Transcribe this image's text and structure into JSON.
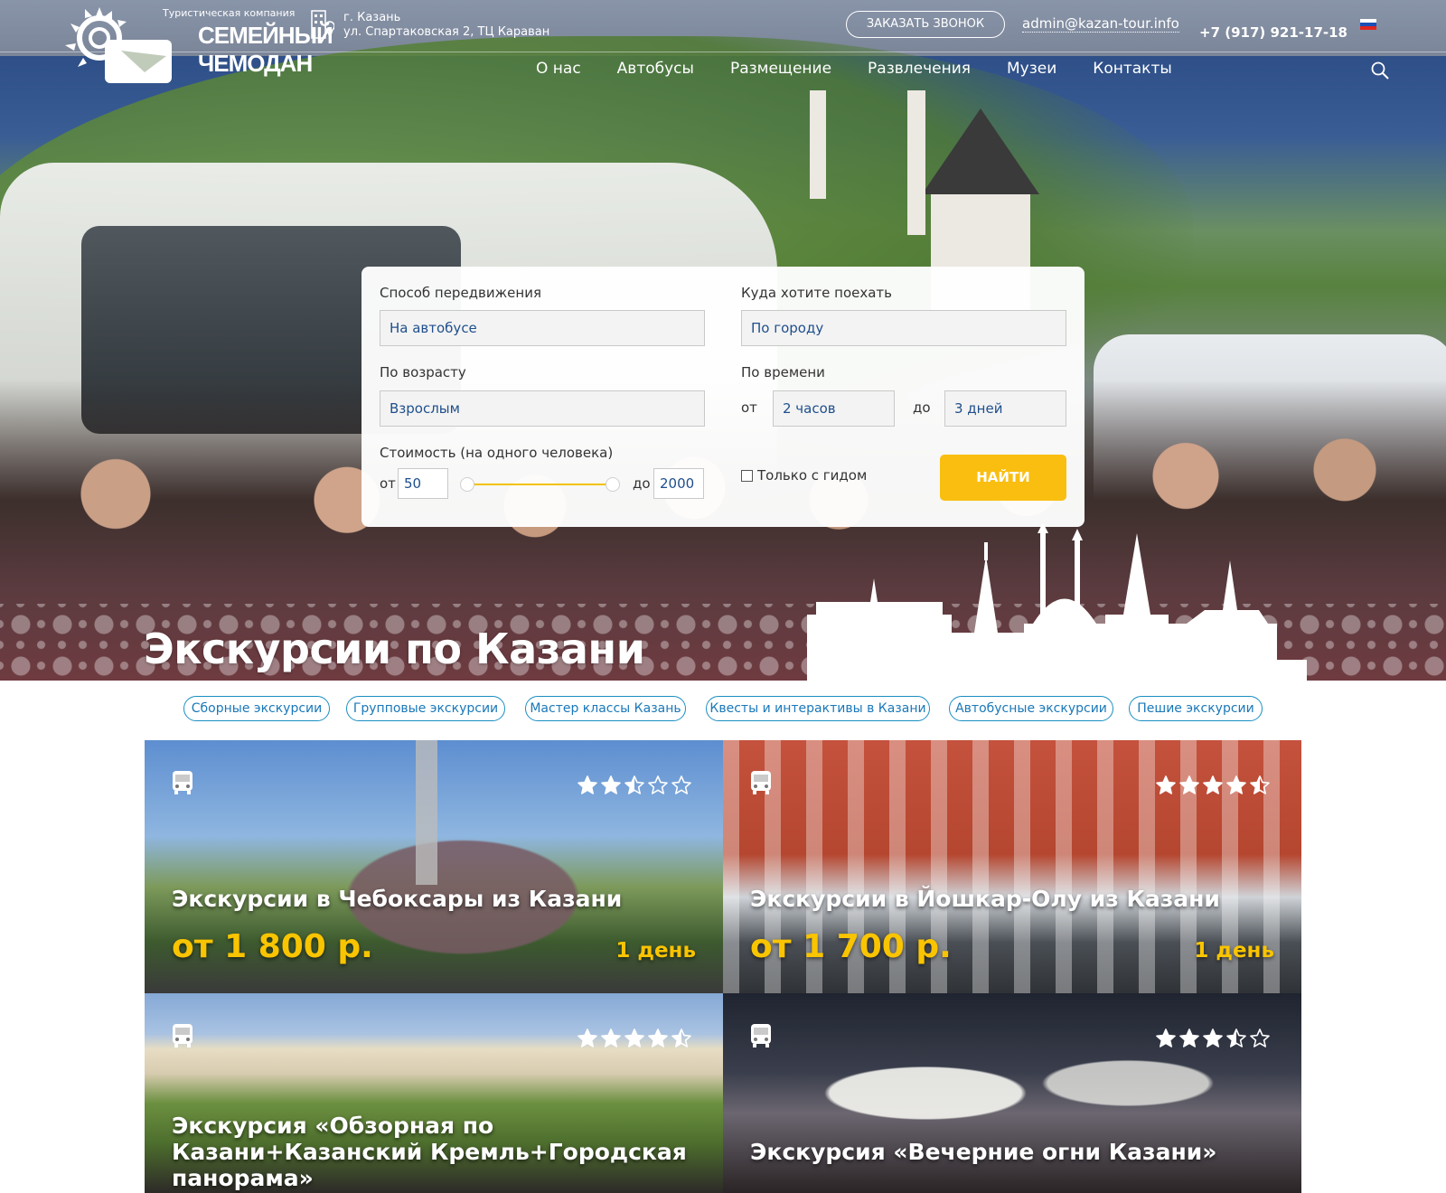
{
  "header": {
    "logo_subtitle": "Туристическая компания",
    "logo_name_line1": "СЕМЕЙНЫЙ",
    "logo_name_line2": "ЧЕМОДАН",
    "address_city": "г. Казань",
    "address_street": "ул. Спартаковская 2, ТЦ Караван",
    "call_button": "ЗАКАЗАТЬ ЗВОНОК",
    "email": "admin@kazan-tour.info",
    "phone": "+7 (917) 921-17-18",
    "language_flag": "ru-flag-icon",
    "nav": [
      "О нас",
      "Автобусы",
      "Размещение",
      "Развлечения",
      "Музеи",
      "Контакты"
    ],
    "search_icon": "search-icon"
  },
  "search_form": {
    "transport_label": "Способ передвижения",
    "transport_value": "На автобусе",
    "destination_label": "Куда хотите поехать",
    "destination_value": "По городу",
    "age_label": "По возрасту",
    "age_value": "Взрослым",
    "time_label": "По времени",
    "time_from_prefix": "от",
    "time_from_value": "2 часов",
    "time_to_prefix": "до",
    "time_to_value": "3 дней",
    "cost_label": "Стоимость (на одного человека)",
    "cost_from_prefix": "от",
    "cost_from_value": "50",
    "cost_to_prefix": "до",
    "cost_to_value": "2000",
    "guide_label": "Только с гидом",
    "guide_checked": false,
    "find_button": "НАЙТИ"
  },
  "hero_title": "Экскурсии по Казани",
  "categories": [
    "Сборные экскурсии",
    "Групповые экскурсии",
    "Мастер классы Казань",
    "Квесты и интерактивы в Казани",
    "Автобусные экскурсии",
    "Пешие экскурсии"
  ],
  "tours": [
    {
      "title": "Экскурсии в Чебоксары из Казани",
      "price": "от 1 800 р.",
      "duration": "1 день",
      "rating": 2.5,
      "icon": "bus-icon"
    },
    {
      "title": "Экскурсии в Йошкар-Олу из Казани",
      "price": "от 1 700 р.",
      "duration": "1 день",
      "rating": 4.5,
      "icon": "bus-icon"
    },
    {
      "title": "Экскурсия «Обзорная по Казани+Казанский Кремль+Городская панорама»",
      "price": "",
      "duration": "",
      "rating": 4.5,
      "icon": "bus-icon"
    },
    {
      "title": "Экскурсия «Вечерние огни Казани»",
      "price": "",
      "duration": "",
      "rating": 3.5,
      "icon": "bus-icon"
    }
  ],
  "colors": {
    "accent_yellow": "#f9be10",
    "price_yellow": "#f9c400",
    "chip_blue": "#1a78b8",
    "field_text_blue": "#1f4f8c"
  }
}
